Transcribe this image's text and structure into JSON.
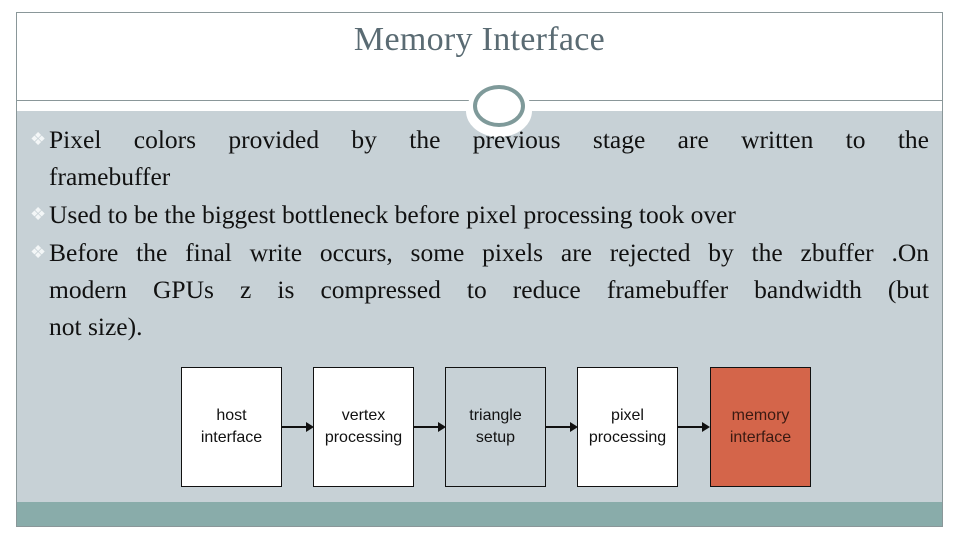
{
  "slide": {
    "title": "Memory Interface",
    "bullet_icon": "diamond-cluster-icon",
    "bullets": [
      {
        "line1": "Pixel colors provided by the previous stage are written to the",
        "line2": "framebuffer"
      },
      {
        "text": "Used to be the biggest bottleneck before pixel processing took over"
      },
      {
        "line1": "Before the final write occurs, some pixels are rejected by the zbuffer .On",
        "line2": "modern GPUs z  is compressed to reduce framebuffer bandwidth (but",
        "line3": "not size)."
      }
    ]
  },
  "diagram": {
    "stages": [
      {
        "label": "host interface",
        "line1": "host",
        "line2": "interface",
        "fill": "#ffffff"
      },
      {
        "label": "vertex processing",
        "line1": "vertex",
        "line2": "processing",
        "fill": "#ffffff"
      },
      {
        "label": "triangle setup",
        "line1": "triangle",
        "line2": "setup",
        "fill": "#c7d1d6"
      },
      {
        "label": "pixel processing",
        "line1": "pixel",
        "line2": "processing",
        "fill": "#ffffff"
      },
      {
        "label": "memory interface",
        "line1": "memory",
        "line2": "interface",
        "fill": "#d4654a",
        "highlighted": true
      }
    ],
    "connections": [
      {
        "from": "host interface",
        "to": "vertex processing"
      },
      {
        "from": "vertex processing",
        "to": "triangle setup"
      },
      {
        "from": "triangle setup",
        "to": "pixel processing"
      },
      {
        "from": "pixel processing",
        "to": "memory interface"
      }
    ]
  },
  "colors": {
    "title": "#5a6b73",
    "content_bg": "#c7d1d6",
    "footer_bar": "#89acaa",
    "highlight": "#d4654a"
  }
}
